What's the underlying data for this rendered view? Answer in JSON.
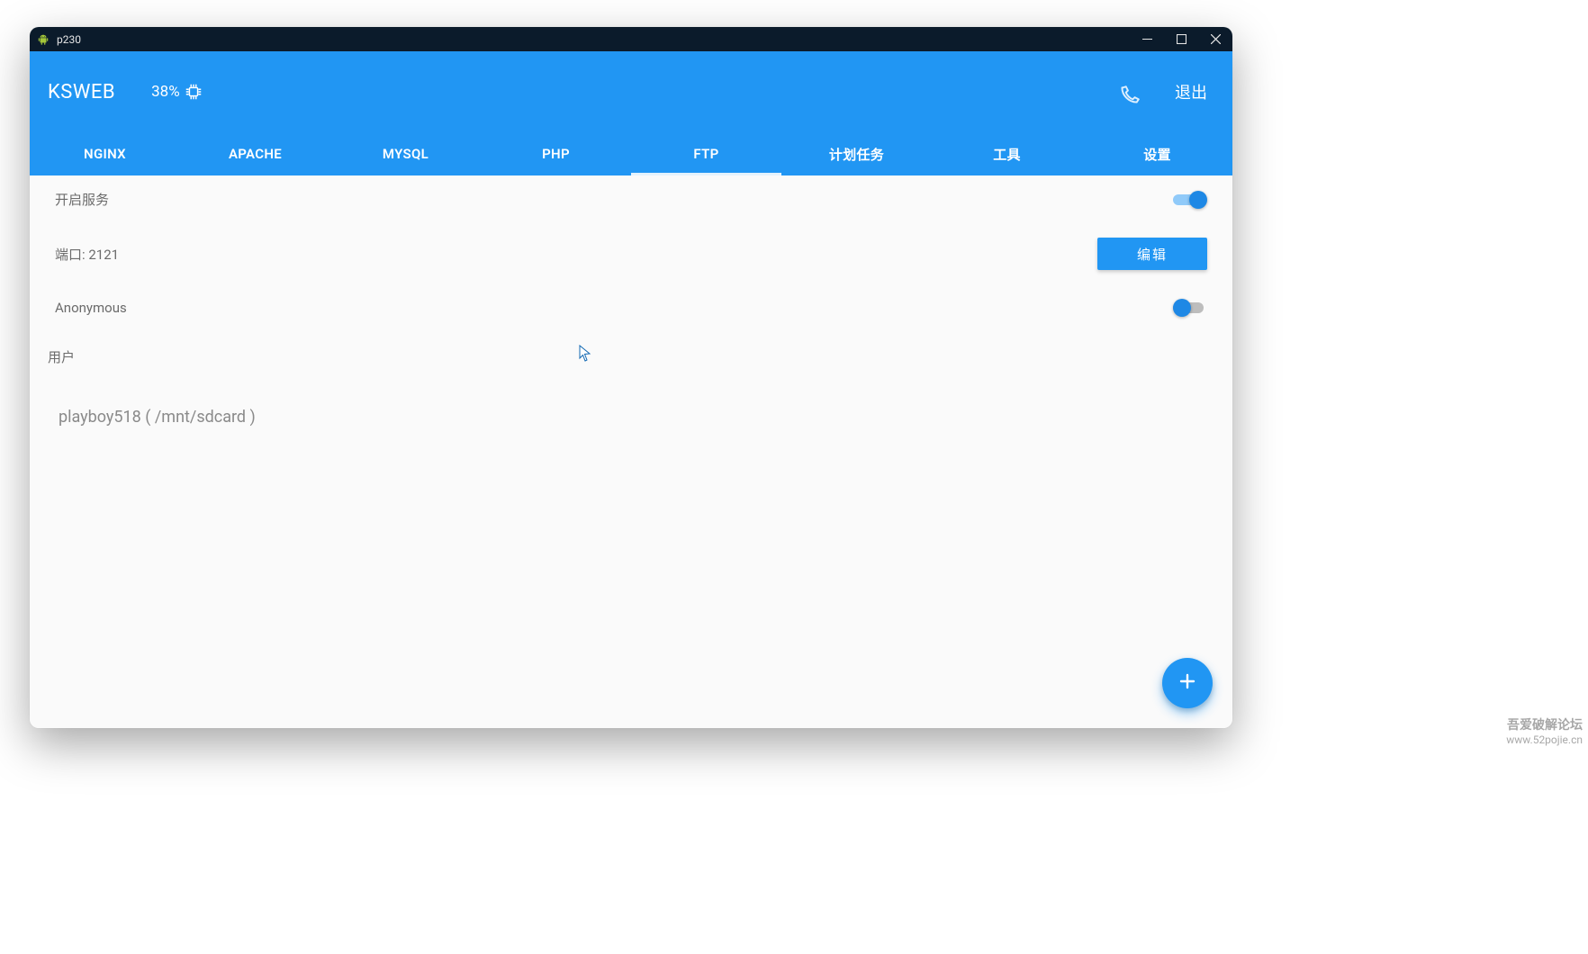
{
  "window": {
    "title": "p230"
  },
  "header": {
    "app_name": "KSWEB",
    "cpu_percent": "38%",
    "exit_label": "退出"
  },
  "tabs": [
    {
      "id": "nginx",
      "label": "NGINX",
      "active": false
    },
    {
      "id": "apache",
      "label": "APACHE",
      "active": false
    },
    {
      "id": "mysql",
      "label": "MYSQL",
      "active": false
    },
    {
      "id": "php",
      "label": "PHP",
      "active": false
    },
    {
      "id": "ftp",
      "label": "FTP",
      "active": true
    },
    {
      "id": "cron",
      "label": "计划任务",
      "active": false
    },
    {
      "id": "tools",
      "label": "工具",
      "active": false
    },
    {
      "id": "settings",
      "label": "设置",
      "active": false
    }
  ],
  "ftp": {
    "service_label": "开启服务",
    "service_on": true,
    "port_label": "端口: 2121",
    "edit_button": "编辑",
    "anonymous_label": "Anonymous",
    "anonymous_on": false,
    "users_header": "用户",
    "users": [
      {
        "display": "playboy518 ( /mnt/sdcard )"
      }
    ]
  },
  "fab": {
    "label": "+"
  },
  "watermark": {
    "line1": "吾爱破解论坛",
    "line2": "www.52pojie.cn"
  },
  "colors": {
    "primary": "#2196f3",
    "titlebar": "#0b1b2b"
  }
}
